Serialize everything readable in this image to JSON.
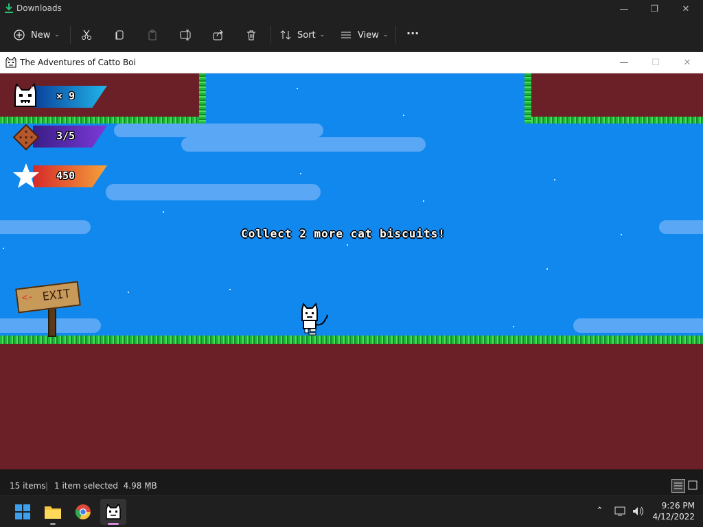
{
  "explorer": {
    "title": "Downloads",
    "toolbar": {
      "new_label": "New",
      "sort_label": "Sort",
      "view_label": "View",
      "more_label": "···"
    }
  },
  "game_window": {
    "title": "The Adventures of Catto Boi"
  },
  "hud": {
    "lives": "× 9",
    "biscuits": "3/5",
    "score": "450"
  },
  "game": {
    "message": "Collect 2 more cat biscuits!",
    "exit_sign": "EXIT"
  },
  "statusbar": {
    "item_count": "15 items",
    "selection": "1 item selected  4.98 MB"
  },
  "taskbar": {
    "time": "9:26 PM",
    "date": "4/12/2022"
  },
  "colors": {
    "sky": "#1188ee",
    "ground": "#6b1f26",
    "grass": "#1fb83a"
  }
}
